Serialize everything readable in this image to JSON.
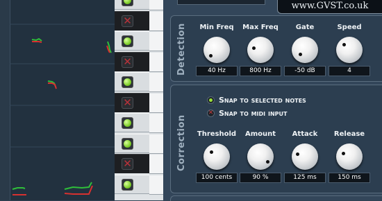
{
  "logo": {
    "text": "www.GVST.co.uk"
  },
  "detection": {
    "title": "Detection",
    "controls": [
      {
        "label": "Min Freq",
        "value": "40 Hz"
      },
      {
        "label": "Max Freq",
        "value": "800 Hz"
      },
      {
        "label": "Gate",
        "value": "-50 dB"
      },
      {
        "label": "Speed",
        "value": "4"
      }
    ]
  },
  "correction": {
    "title": "Correction",
    "options": [
      {
        "label": "Snap to selected notes",
        "selected": true
      },
      {
        "label": "Snap to midi input",
        "selected": false
      }
    ],
    "controls": [
      {
        "label": "Threshold",
        "value": "100 cents"
      },
      {
        "label": "Amount",
        "value": "90 %"
      },
      {
        "label": "Attack",
        "value": "125 ms"
      },
      {
        "label": "Release",
        "value": "150 ms"
      }
    ]
  },
  "note_pads": [
    {
      "state": "on"
    },
    {
      "state": "off"
    },
    {
      "state": "on"
    },
    {
      "state": "off"
    },
    {
      "state": "on"
    },
    {
      "state": "off"
    },
    {
      "state": "on"
    },
    {
      "state": "on"
    },
    {
      "state": "off"
    },
    {
      "state": "on"
    }
  ],
  "colors": {
    "detected_pitch": "#2fbf3a",
    "corrected_pitch": "#d8312f",
    "accent_on": "#7fcf2a"
  }
}
